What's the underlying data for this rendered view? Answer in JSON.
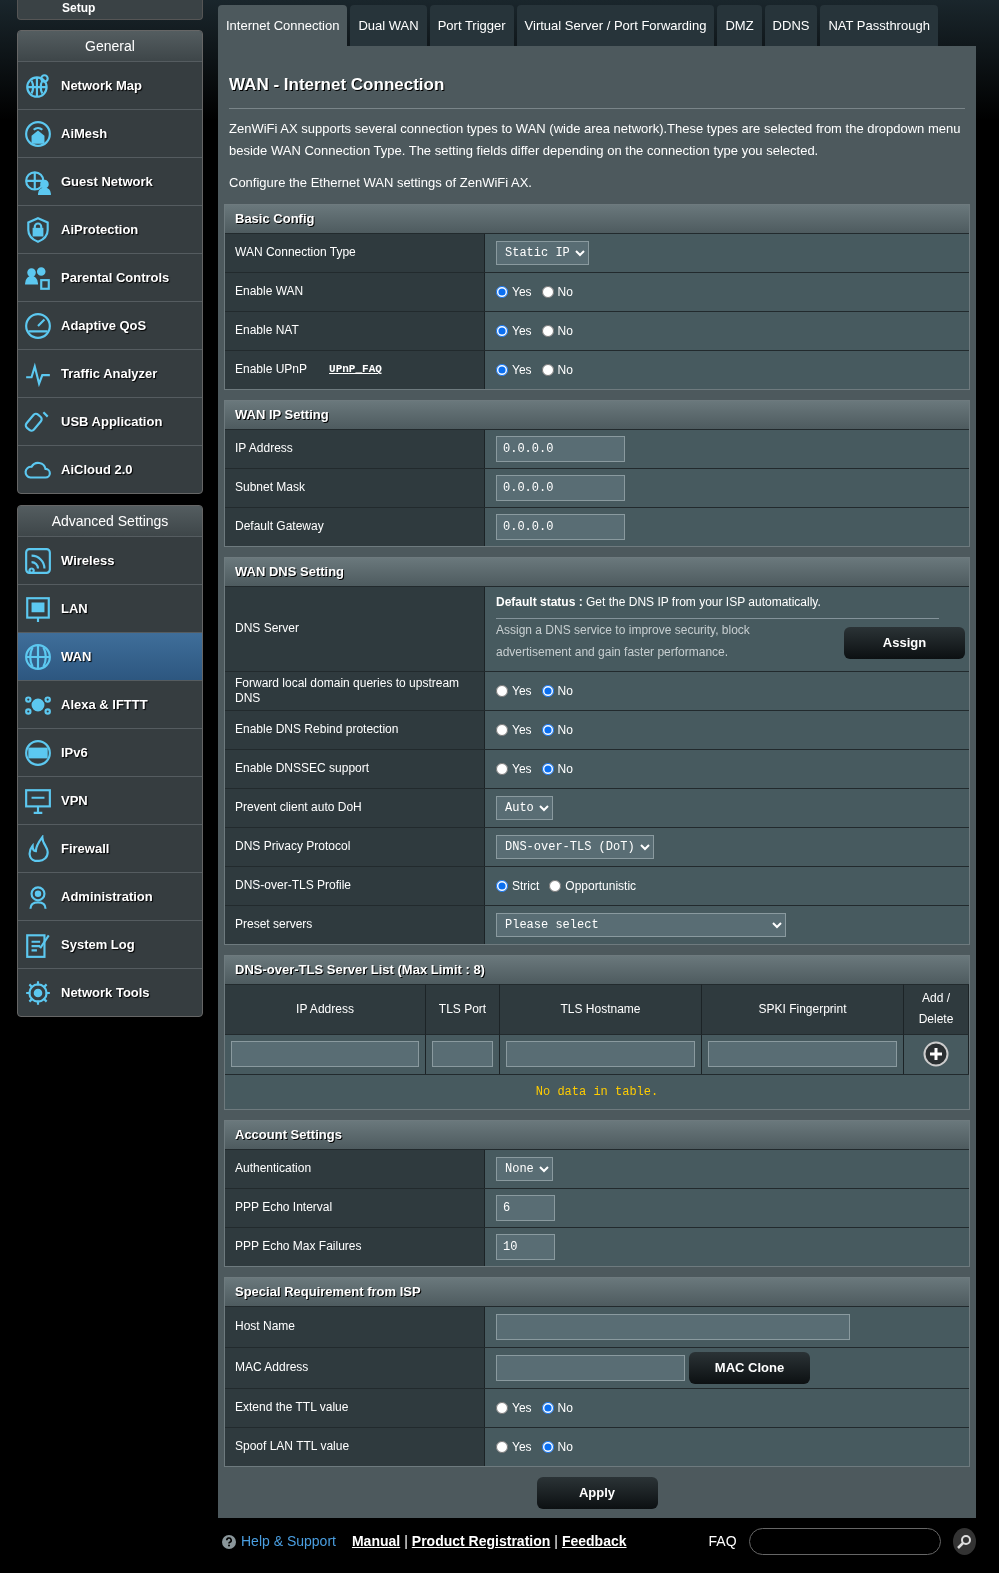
{
  "sidebar": {
    "quick_setup": "Setup",
    "groups": [
      {
        "title": "General",
        "items": [
          {
            "label": "Network Map",
            "selected": false
          },
          {
            "label": "AiMesh",
            "selected": false
          },
          {
            "label": "Guest Network",
            "selected": false
          },
          {
            "label": "AiProtection",
            "selected": false
          },
          {
            "label": "Parental Controls",
            "selected": false
          },
          {
            "label": "Adaptive QoS",
            "selected": false
          },
          {
            "label": "Traffic Analyzer",
            "selected": false
          },
          {
            "label": "USB Application",
            "selected": false
          },
          {
            "label": "AiCloud 2.0",
            "selected": false
          }
        ]
      },
      {
        "title": "Advanced Settings",
        "items": [
          {
            "label": "Wireless",
            "selected": false
          },
          {
            "label": "LAN",
            "selected": false
          },
          {
            "label": "WAN",
            "selected": true
          },
          {
            "label": "Alexa & IFTTT",
            "selected": false
          },
          {
            "label": "IPv6",
            "selected": false
          },
          {
            "label": "VPN",
            "selected": false
          },
          {
            "label": "Firewall",
            "selected": false
          },
          {
            "label": "Administration",
            "selected": false
          },
          {
            "label": "System Log",
            "selected": false
          },
          {
            "label": "Network Tools",
            "selected": false
          }
        ]
      }
    ]
  },
  "tabs": [
    {
      "label": "Internet Connection",
      "selected": true
    },
    {
      "label": "Dual WAN",
      "selected": false
    },
    {
      "label": "Port Trigger",
      "selected": false
    },
    {
      "label": "Virtual Server / Port Forwarding",
      "selected": false
    },
    {
      "label": "DMZ",
      "selected": false
    },
    {
      "label": "DDNS",
      "selected": false
    },
    {
      "label": "NAT Passthrough",
      "selected": false
    }
  ],
  "page": {
    "title": "WAN - Internet Connection",
    "description": "ZenWiFi AX supports several connection types to WAN (wide area network).These types are selected from the dropdown menu beside WAN Connection Type. The setting fields differ depending on the connection type you selected.",
    "note": "Configure the Ethernet WAN settings of ZenWiFi AX."
  },
  "sections": [
    {
      "kind": "form",
      "title": "Basic Config",
      "rows": [
        {
          "kind": "select",
          "label": "WAN Connection Type",
          "value": "Static IP"
        },
        {
          "kind": "radio",
          "label": "Enable WAN",
          "options": [
            {
              "label": "Yes",
              "selected": true
            },
            {
              "label": "No",
              "selected": false
            }
          ]
        },
        {
          "kind": "radio",
          "label": "Enable NAT",
          "options": [
            {
              "label": "Yes",
              "selected": true
            },
            {
              "label": "No",
              "selected": false
            }
          ]
        },
        {
          "kind": "radio",
          "label": "Enable UPnP",
          "link": "UPnP_FAQ",
          "options": [
            {
              "label": "Yes",
              "selected": true
            },
            {
              "label": "No",
              "selected": false
            }
          ]
        }
      ]
    },
    {
      "kind": "form",
      "title": "WAN IP Setting",
      "rows": [
        {
          "kind": "ip",
          "label": "IP Address",
          "value": "0.0.0.0"
        },
        {
          "kind": "ip",
          "label": "Subnet Mask",
          "value": "0.0.0.0"
        },
        {
          "kind": "ip",
          "label": "Default Gateway",
          "value": "0.0.0.0"
        }
      ]
    },
    {
      "kind": "form",
      "title": "WAN DNS Setting",
      "rows": [
        {
          "kind": "dns",
          "label": "DNS Server",
          "status": "**Default status :** Get the DNS IP from your ISP automatically.",
          "hint": "Assign a DNS service to improve security, block advertisement and gain faster performance.",
          "button": "Assign"
        },
        {
          "kind": "radio",
          "label": "Forward local domain queries to upstream DNS",
          "options": [
            {
              "label": "Yes",
              "selected": false
            },
            {
              "label": "No",
              "selected": true
            }
          ]
        },
        {
          "kind": "radio",
          "label": "Enable DNS Rebind protection",
          "options": [
            {
              "label": "Yes",
              "selected": false
            },
            {
              "label": "No",
              "selected": true
            }
          ]
        },
        {
          "kind": "radio",
          "label": "Enable DNSSEC support",
          "options": [
            {
              "label": "Yes",
              "selected": false
            },
            {
              "label": "No",
              "selected": true
            }
          ]
        },
        {
          "kind": "select",
          "label": "Prevent client auto DoH",
          "value": "Auto"
        },
        {
          "kind": "select",
          "label": "DNS Privacy Protocol",
          "value": "DNS-over-TLS (DoT)"
        },
        {
          "kind": "radio",
          "label": "DNS-over-TLS Profile",
          "options": [
            {
              "label": "Strict",
              "selected": true
            },
            {
              "label": "Opportunistic",
              "selected": false
            }
          ]
        },
        {
          "kind": "wideselect",
          "label": "Preset servers",
          "value": "Please select"
        }
      ]
    },
    {
      "kind": "list",
      "title": "DNS-over-TLS Server List (Max Limit : 8)",
      "columns": [
        "IP Address",
        "TLS Port",
        "TLS Hostname",
        "SPKI Fingerprint",
        "Add / Delete"
      ],
      "empty_text": "No data in table."
    },
    {
      "kind": "form",
      "title": "Account Settings",
      "rows": [
        {
          "kind": "select",
          "label": "Authentication",
          "value": "None"
        },
        {
          "kind": "number",
          "label": "PPP Echo Interval",
          "value": "6"
        },
        {
          "kind": "number",
          "label": "PPP Echo Max Failures",
          "value": "10"
        }
      ]
    },
    {
      "kind": "form",
      "title": "Special Requirement from ISP",
      "rows": [
        {
          "kind": "text",
          "label": "Host Name"
        },
        {
          "kind": "textbutton",
          "label": "MAC Address",
          "button": "MAC Clone"
        },
        {
          "kind": "radio",
          "label": "Extend the TTL value",
          "options": [
            {
              "label": "Yes",
              "selected": false
            },
            {
              "label": "No",
              "selected": true
            }
          ]
        },
        {
          "kind": "radio",
          "label": "Spoof LAN TTL value",
          "options": [
            {
              "label": "Yes",
              "selected": false
            },
            {
              "label": "No",
              "selected": true
            }
          ]
        }
      ]
    }
  ],
  "apply_button": "Apply",
  "footer": {
    "help": "Help & Support",
    "links": [
      "Manual",
      "Product Registration",
      "Feedback"
    ],
    "separator": "|",
    "faq_label": "FAQ"
  }
}
